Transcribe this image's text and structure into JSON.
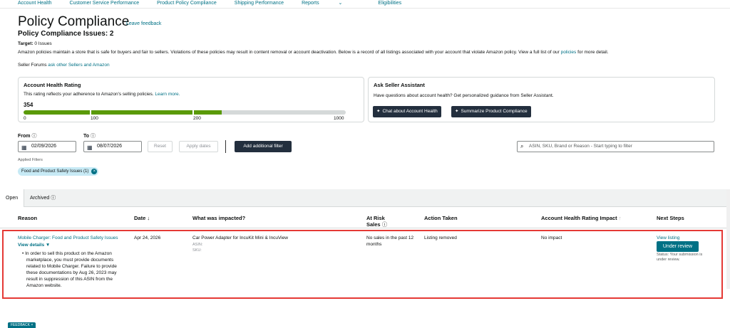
{
  "topnav": [
    "Account Health",
    "Customer Service Performance",
    "Product Policy Compliance",
    "Shipping Performance",
    "Reports",
    "Eligibilities"
  ],
  "header": {
    "title": "Policy Compliance",
    "leave_feedback": "Leave feedback",
    "issues": "Policy Compliance Issues: 2",
    "target_label": "Target:",
    "target_value": "0 Issues",
    "intro": "Amazon policies maintain a store that is safe for buyers and fair to sellers. Violations of these policies may result in content removal or account deactivation. Below is a record of all listings associated with your account that violate Amazon policy. View a full list of our",
    "intro_link": "policies",
    "intro_end": "for more detail.",
    "forums_label": "Seller Forums",
    "forums_link": "ask other Sellers and Amazon"
  },
  "rating_card": {
    "title": "Account Health Rating",
    "desc": "This rating reflects your adherence to Amazon's selling policies.",
    "learn_more": "Learn more.",
    "value": "354",
    "value_fraction": 0.354,
    "scale": [
      "0",
      "100",
      "200",
      "1000"
    ]
  },
  "assistant_card": {
    "title": "Ask Seller Assistant",
    "desc": "Have questions about account health? Get personalized guidance from Seller Assistant.",
    "btn_chat": "Chat about Account Health",
    "btn_summarize": "Summarize Product Compliance"
  },
  "filters": {
    "from_label": "From",
    "to_label": "To",
    "from_value": "02/09/2026",
    "to_value": "08/07/2026",
    "reset": "Reset",
    "apply": "Apply dates",
    "add_filter": "Add additional filter",
    "search_placeholder": "ASIN, SKU, Brand or Reason - Start typing to filter",
    "applied_label": "Applied Filters",
    "chip": "Food and Product Safety Issues (1)"
  },
  "tabs": {
    "open": "Open",
    "archived": "Archived"
  },
  "table": {
    "headers": {
      "reason": "Reason",
      "date": "Date",
      "impacted": "What was impacted?",
      "at_risk": "At Risk",
      "sales": "Sales",
      "action": "Action Taken",
      "ahr_impact": "Account Health Rating Impact",
      "next": "Next Steps"
    },
    "row": {
      "reason": "Mobile Charger: Food and Product Safety Issues",
      "view_details": "View details",
      "detail_lines": [
        "In order to sell this product on the Amazon",
        "marketplace, you must provide documents",
        "related to Mobile Charger. Failure to provide",
        "these documentations by Aug 26, 2023 may",
        "result in suppression of this ASIN from the",
        "Amazon website."
      ],
      "date": "Apr 24, 2026",
      "product": "Car Power Adapter for IncuKit Mini & IncuView",
      "asin": "ASIN: ",
      "sku": "SKU: ",
      "sales_line1": "No sales in the past 12",
      "sales_line2": "months",
      "action": "Listing removed",
      "impact": "No impact",
      "view_listing": "View listing",
      "under_review": "Under review",
      "status_line1": "Status: Your submission is",
      "status_line2": "under review."
    }
  },
  "feedback": "FEEDBACK"
}
